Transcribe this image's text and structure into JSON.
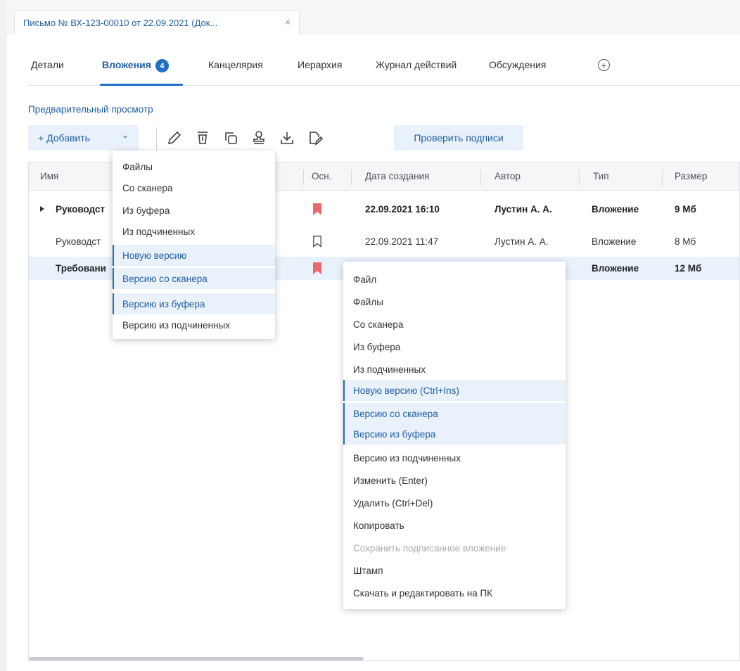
{
  "window_tab": {
    "title": "Письмо № ВХ-123-00010 от 22.09.2021 (Док...",
    "close": "×"
  },
  "tabs": [
    {
      "label": "Детали"
    },
    {
      "label": "Вложения",
      "badge": "4"
    },
    {
      "label": "Канцелярия"
    },
    {
      "label": "Иерархия"
    },
    {
      "label": "Журнал действий"
    },
    {
      "label": "Обсуждения"
    }
  ],
  "tab_add": "+",
  "preview_link": "Предварительный просмотр",
  "toolbar": {
    "add_label": "+ Добавить",
    "add_chevron": "⌄",
    "check_signatures": "Проверить подписи",
    "icons": [
      "edit-icon",
      "delete-icon",
      "copy-icon",
      "stamp-icon",
      "download-icon",
      "edit-document-icon"
    ]
  },
  "table": {
    "headers": [
      "Имя",
      "Осн.",
      "Дата создания",
      "Автор",
      "Тип",
      "Размер"
    ],
    "rows": [
      {
        "name": "Руководст",
        "main": true,
        "date": "22.09.2021 16:10",
        "author": "Лустин А. А.",
        "type": "Вложение",
        "size": "9 Мб",
        "bold": true,
        "expandable": true
      },
      {
        "name": "Руководст",
        "main": false,
        "date": "22.09.2021 11:47",
        "author": "Лустин А. А.",
        "type": "Вложение",
        "size": "8 Мб",
        "bold": false
      },
      {
        "name": "Требовани",
        "main": true,
        "date": "",
        "author": "",
        "type": "Вложение",
        "size": "12 Мб",
        "bold": true,
        "selected": true
      }
    ]
  },
  "add_menu": [
    {
      "label": "Файлы"
    },
    {
      "label": "Со сканера"
    },
    {
      "label": "Из буфера"
    },
    {
      "label": "Из подчиненных"
    },
    {
      "label": "Новую версию",
      "highlighted": true
    },
    {
      "label": "Версию со сканера",
      "highlighted": true
    },
    {
      "label": "Версию из буфера",
      "highlighted": true
    },
    {
      "label": "Версию из подчиненных"
    }
  ],
  "context_menu": [
    {
      "label": "Файл"
    },
    {
      "label": "Файлы"
    },
    {
      "label": "Со сканера"
    },
    {
      "label": "Из буфера"
    },
    {
      "label": "Из подчиненных"
    },
    {
      "label": "Новую версию (Ctrl+Ins)",
      "highlighted": true
    },
    {
      "label": "Версию со сканера",
      "highlighted": true
    },
    {
      "label": "Версию из буфера",
      "highlighted": true
    },
    {
      "label": "Версию из подчиненных"
    },
    {
      "label": "Изменить (Enter)"
    },
    {
      "label": "Удалить (Ctrl+Del)"
    },
    {
      "label": "Копировать"
    },
    {
      "label": "Сохранить подписанное вложение",
      "disabled": true
    },
    {
      "label": "Штамп"
    },
    {
      "label": "Скачать и редактировать на ПК"
    }
  ],
  "colors": {
    "accent": "#1f6fc6",
    "link": "#1f5fa8",
    "flag": "#e8686b",
    "highlight_bg": "#e9f1fb"
  }
}
